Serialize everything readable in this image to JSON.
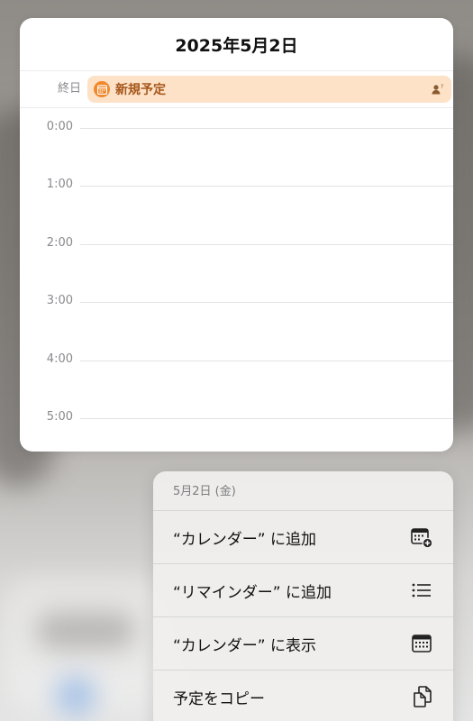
{
  "calendar_preview": {
    "date_title": "2025年5月2日",
    "allday_label": "終日",
    "event": {
      "title": "新規予定",
      "icon": "calendar-icon",
      "accent_color": "#f0892e",
      "background_color": "#fde2c8"
    },
    "hours": [
      "0:00",
      "1:00",
      "2:00",
      "3:00",
      "4:00",
      "5:00"
    ]
  },
  "context_menu": {
    "header": "5月2日 (金)",
    "items": [
      {
        "label": "“カレンダー” に追加",
        "icon": "calendar-add-icon"
      },
      {
        "label": "“リマインダー” に追加",
        "icon": "list-icon"
      },
      {
        "label": "“カレンダー” に表示",
        "icon": "calendar-icon"
      },
      {
        "label": "予定をコピー",
        "icon": "copy-icon"
      }
    ]
  }
}
